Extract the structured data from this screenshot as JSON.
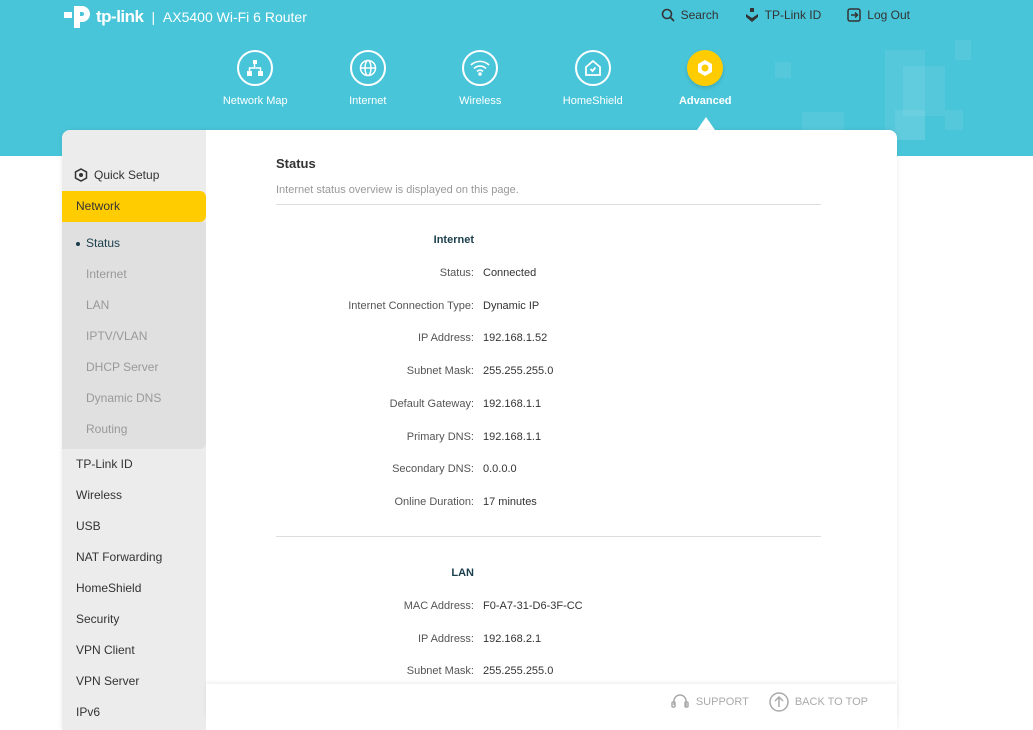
{
  "header": {
    "brand": "tp-link",
    "model": "AX5400 Wi-Fi 6 Router",
    "links": [
      {
        "label": "Search"
      },
      {
        "label": "TP-Link ID"
      },
      {
        "label": "Log Out"
      }
    ],
    "nav": [
      {
        "label": "Network Map"
      },
      {
        "label": "Internet"
      },
      {
        "label": "Wireless"
      },
      {
        "label": "HomeShield"
      },
      {
        "label": "Advanced"
      }
    ]
  },
  "sidebar": {
    "quick_setup": "Quick Setup",
    "network": "Network",
    "sub": [
      "Status",
      "Internet",
      "LAN",
      "IPTV/VLAN",
      "DHCP Server",
      "Dynamic DNS",
      "Routing"
    ],
    "items": [
      "TP-Link ID",
      "Wireless",
      "USB",
      "NAT Forwarding",
      "HomeShield",
      "Security",
      "VPN Client",
      "VPN Server",
      "IPv6"
    ]
  },
  "main": {
    "title": "Status",
    "description": "Internet status overview is displayed on this page.",
    "internet": {
      "heading": "Internet",
      "rows": [
        {
          "label": "Status:",
          "value": "Connected"
        },
        {
          "label": "Internet Connection Type:",
          "value": "Dynamic IP"
        },
        {
          "label": "IP Address:",
          "value": "192.168.1.52"
        },
        {
          "label": "Subnet Mask:",
          "value": "255.255.255.0"
        },
        {
          "label": "Default Gateway:",
          "value": "192.168.1.1"
        },
        {
          "label": "Primary DNS:",
          "value": "192.168.1.1"
        },
        {
          "label": "Secondary DNS:",
          "value": "0.0.0.0"
        },
        {
          "label": "Online Duration:",
          "value": "17 minutes"
        }
      ]
    },
    "lan": {
      "heading": "LAN",
      "rows": [
        {
          "label": "MAC Address:",
          "value": "F0-A7-31-D6-3F-CC"
        },
        {
          "label": "IP Address:",
          "value": "192.168.2.1"
        },
        {
          "label": "Subnet Mask:",
          "value": "255.255.255.0"
        }
      ]
    }
  },
  "footer": {
    "support": "SUPPORT",
    "back_to_top": "BACK TO TOP"
  },
  "colors": {
    "header": "#49c5d9",
    "accent": "#ffcc00"
  }
}
